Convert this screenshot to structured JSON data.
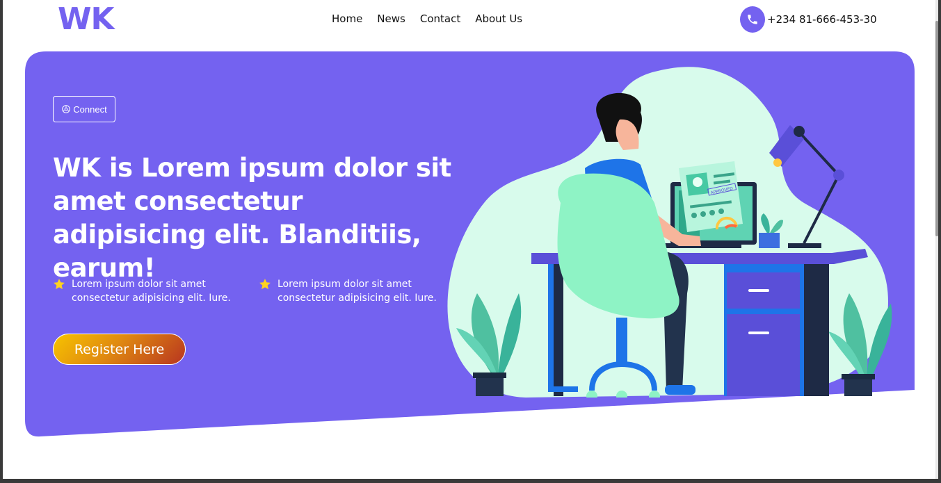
{
  "header": {
    "logo": "WK",
    "nav": [
      "Home",
      "News",
      "Contact",
      "About Us"
    ],
    "phone": "+234 81-666-453-30"
  },
  "hero": {
    "connect_label": "Connect",
    "headline": "WK is Lorem ipsum dolor sit amet consectetur adipisicing elit. Blanditiis, earum!",
    "features": [
      "Lorem ipsum dolor sit amet consectetur adipisicing elit. Iure.",
      "Lorem ipsum dolor sit amet consectetur adipisicing elit. Iure."
    ],
    "register_label": "Register Here",
    "approved_stamp": "APPROVED"
  },
  "colors": {
    "brand": "#7462f0",
    "hero_bg": "#7462f0",
    "blob": "#d8fbec",
    "star": "#ffd21f"
  },
  "icons": {
    "phone": "phone-icon",
    "connect": "network-icon",
    "feature": "star-icon"
  }
}
